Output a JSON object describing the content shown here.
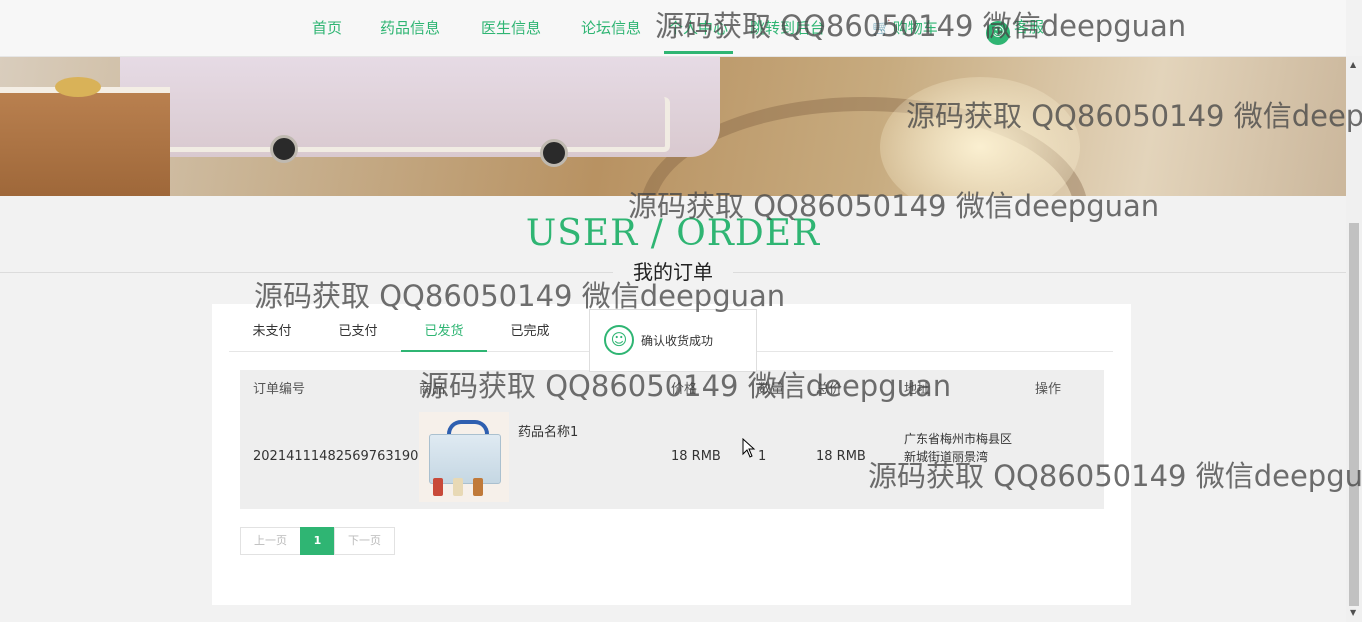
{
  "nav": {
    "items": [
      {
        "label": "首页"
      },
      {
        "label": "药品信息"
      },
      {
        "label": "医生信息"
      },
      {
        "label": "论坛信息"
      },
      {
        "label": "个人中心"
      },
      {
        "label": "跳转到后台"
      },
      {
        "label": "购物车"
      },
      {
        "label": "客服"
      }
    ],
    "active_index": 4
  },
  "page": {
    "title": "USER / ORDER",
    "subtitle": "我的订单"
  },
  "tabs": [
    "未支付",
    "已支付",
    "已发货",
    "已完成"
  ],
  "active_tab": "已发货",
  "toast": {
    "message": "确认收货成功",
    "icon": "smile-icon"
  },
  "table": {
    "columns": [
      "订单编号",
      "商品",
      "价格",
      "数量",
      "总价",
      "地址",
      "操作"
    ],
    "rows": [
      {
        "order_no": "20214111482569763190",
        "product_name": "药品名称1",
        "price": "18 RMB",
        "quantity": "1",
        "total": "18 RMB",
        "address": "广东省梅州市梅县区新城街道丽景湾",
        "action": ""
      }
    ]
  },
  "pagination": {
    "prev": "上一页",
    "current": "1",
    "next": "下一页"
  },
  "watermark": "源码获取 QQ86050149 微信deepguan",
  "colors": {
    "accent": "#2fb573",
    "background": "#f2f2f2",
    "table_bg": "#eeeeee"
  }
}
